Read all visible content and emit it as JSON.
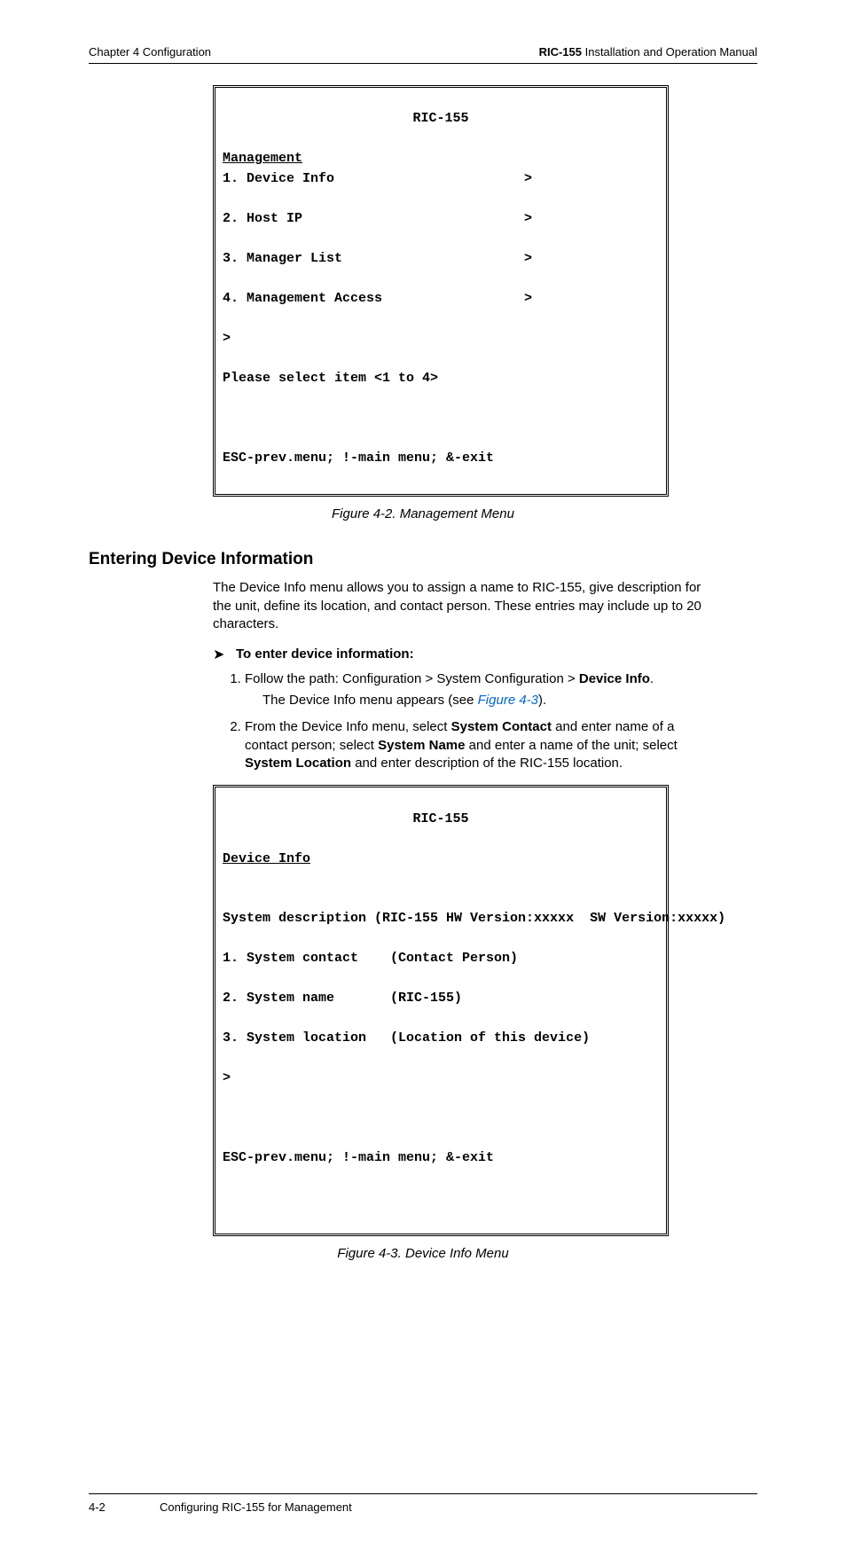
{
  "header": {
    "left": "Chapter 4  Configuration",
    "right_bold": "RIC-155",
    "right_rest": " Installation and Operation Manual"
  },
  "terminal1": {
    "title": "RIC-155",
    "section": "Management",
    "items": [
      {
        "label": "1. Device Info",
        "arrow": ">"
      },
      {
        "label": "2. Host IP",
        "arrow": ">"
      },
      {
        "label": "3. Manager List",
        "arrow": ">"
      },
      {
        "label": "4. Management Access",
        "arrow": ">"
      }
    ],
    "prompt": ">",
    "select_line": "Please select item <1 to 4>",
    "footer": "ESC-prev.menu; !-main menu; &-exit"
  },
  "caption1": "Figure 4-2.  Management Menu",
  "heading": "Entering Device Information",
  "para1": "The Device Info menu allows you to assign a name to RIC-155, give description for the unit, define its location, and contact person. These entries may include up to 20 characters.",
  "arrow_text": "To enter device information:",
  "step1_a": "Follow the path: Configuration > System Configuration > ",
  "step1_b": "Device Info",
  "step1_c": ".",
  "step1_sub_a": "The Device Info menu appears (see ",
  "step1_sub_link": "Figure 4-3",
  "step1_sub_b": ").",
  "step2_a": "From the Device Info menu, select ",
  "step2_b": "System Contact",
  "step2_c": " and enter name of a contact person; select ",
  "step2_d": "System Name",
  "step2_e": " and enter a name of the unit; select ",
  "step2_f": "System Location",
  "step2_g": " and enter description of the RIC-155 location.",
  "terminal2": {
    "title": "RIC-155",
    "section": "Device Info",
    "desc": "System description (RIC-155 HW Version:xxxxx  SW Version:xxxxx)",
    "items": [
      "1. System contact    (Contact Person)",
      "2. System name       (RIC-155)",
      "3. System location   (Location of this device)"
    ],
    "prompt": ">",
    "footer": "ESC-prev.menu; !-main menu; &-exit"
  },
  "caption2": "Figure 4-3.  Device Info Menu",
  "footer": {
    "page": "4-2",
    "text": "Configuring RIC-155 for Management"
  }
}
